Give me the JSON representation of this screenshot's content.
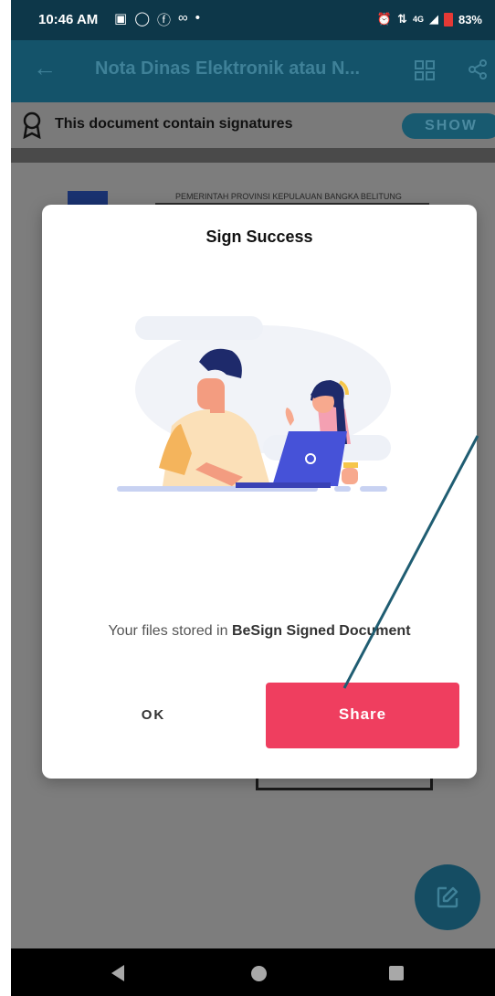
{
  "status_bar": {
    "time": "10:46 AM",
    "network": "4G",
    "battery": "83%",
    "icons": [
      "gallery-icon",
      "whatsapp-icon",
      "facebook-icon",
      "voicemail-icon",
      "dot-icon",
      "alarm-icon",
      "data-arrows-icon",
      "signal-icon",
      "battery-icon"
    ]
  },
  "app_bar": {
    "title": "Nota Dinas Elektronik atau N...",
    "icons": [
      "back-arrow-icon",
      "grid-icon",
      "share-icon"
    ]
  },
  "signature_banner": {
    "text": "This document contain signatures",
    "button_label": "SHOW"
  },
  "document": {
    "header_line": "PEMERINTAH PROVINSI KEPULAUAN BANGKA BELITUNG"
  },
  "dialog": {
    "title": "Sign Success",
    "message_prefix": "Your files stored in ",
    "message_bold": "BeSign Signed Document",
    "ok_label": "OK",
    "share_label": "Share"
  },
  "colors": {
    "status_bar": "#0d3749",
    "app_bar": "#14536a",
    "share_button": "#ef3e5f",
    "fab": "#154d63"
  }
}
